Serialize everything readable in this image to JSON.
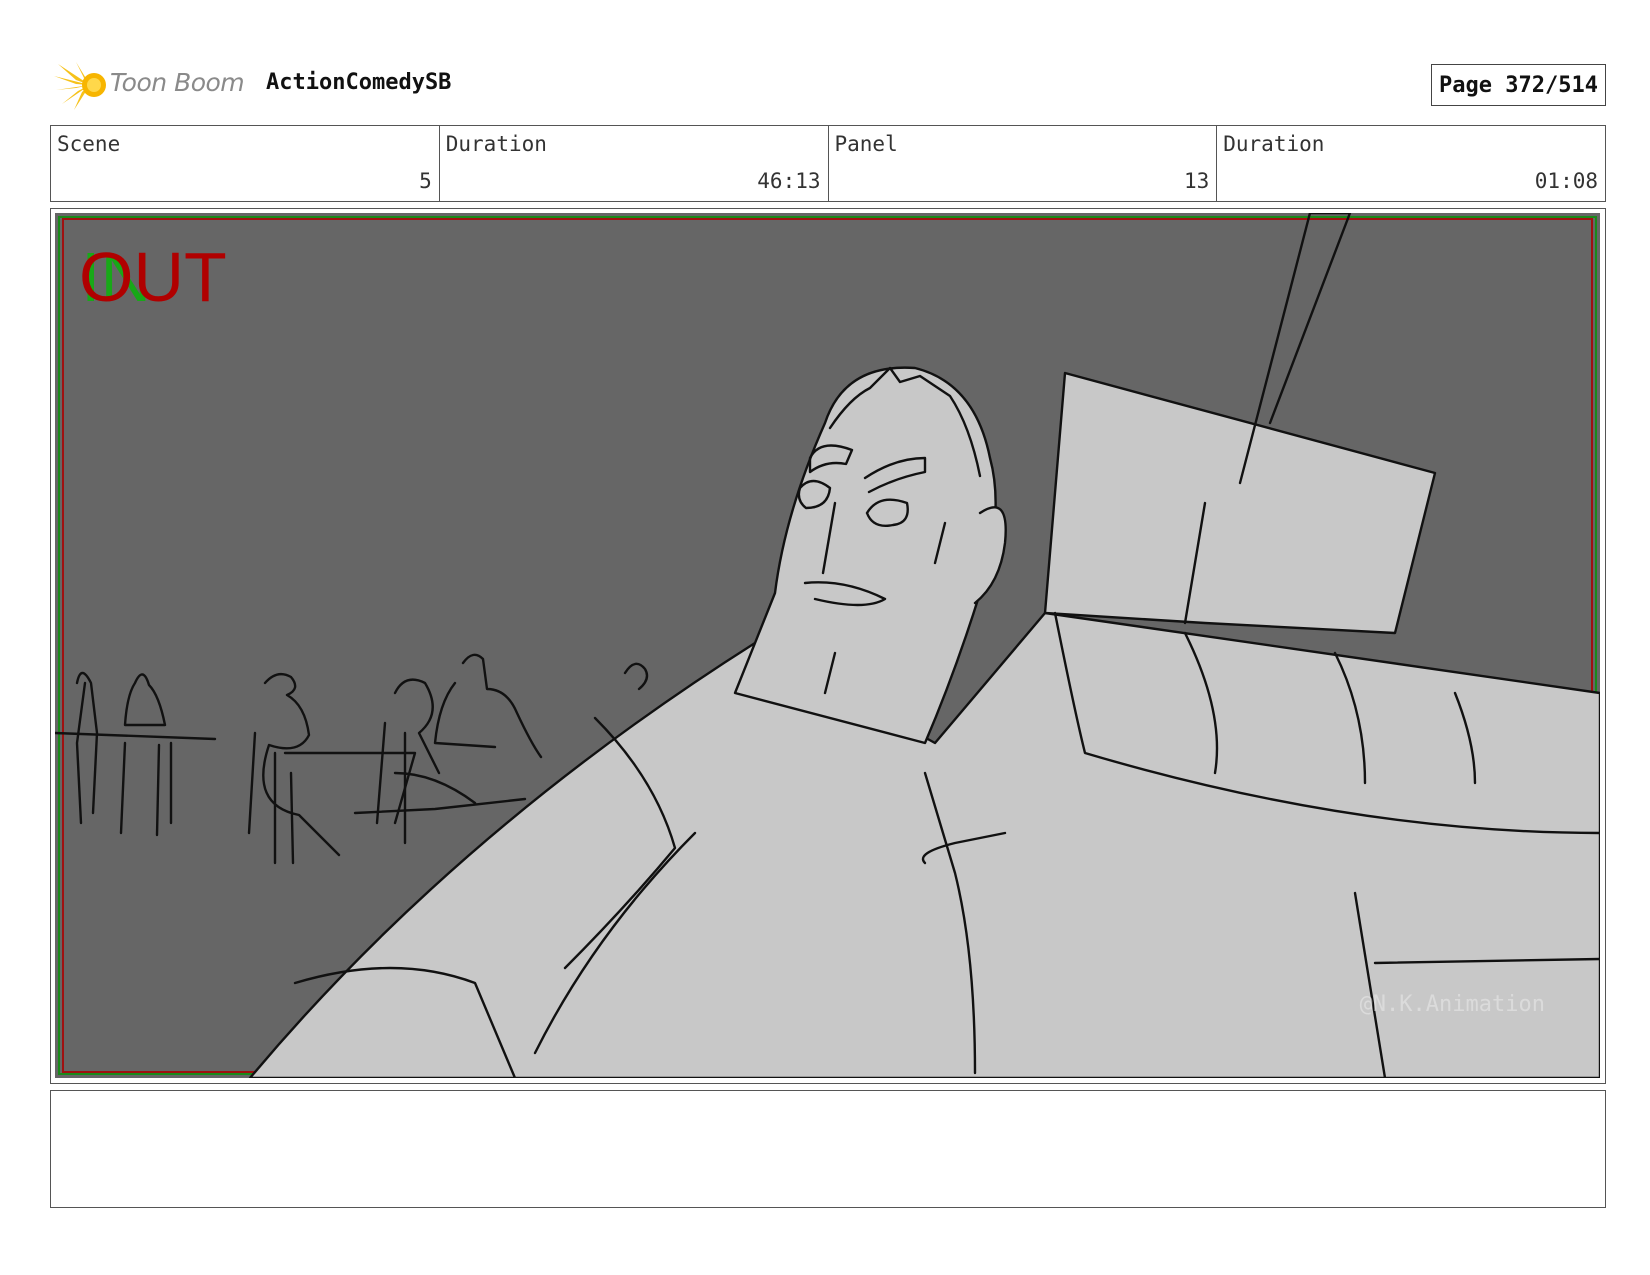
{
  "header": {
    "brand": "Toon Boom",
    "project_title": "ActionComedySB",
    "page_label": "Page 372/514"
  },
  "info": {
    "scene_label": "Scene",
    "scene_value": "5",
    "scene_duration_label": "Duration",
    "scene_duration_value": "46:13",
    "panel_label": "Panel",
    "panel_value": "13",
    "panel_duration_label": "Duration",
    "panel_duration_value": "01:08"
  },
  "panel": {
    "overlay_text": "OUT",
    "overlay_in_text": "IN",
    "watermark": "@N.K.Animation"
  },
  "notes": {
    "text": ""
  },
  "colors": {
    "background_gray": "#666666",
    "fill_gray": "#c8c8c8",
    "out_red": "#b00000",
    "in_green": "#18a818"
  }
}
